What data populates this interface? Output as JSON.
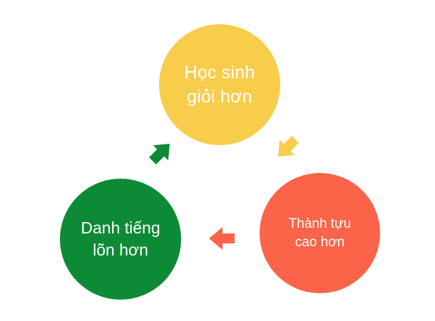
{
  "nodes": {
    "top": {
      "label": "Học sinh\ngiỏi hơn",
      "color": "#F9CD4C"
    },
    "left": {
      "label": "Danh tiếng\nlõn hơn",
      "color": "#0D8A36"
    },
    "right": {
      "label": "Thành tựu\ncao hơn",
      "color": "#FC6449"
    }
  },
  "arrows": {
    "top_to_right": {
      "color": "#F9CD4C",
      "icon": "arrow-down-right-icon"
    },
    "right_to_left": {
      "color": "#FC6449",
      "icon": "arrow-left-icon"
    },
    "left_to_top": {
      "color": "#0D8A36",
      "icon": "arrow-up-right-icon"
    }
  }
}
